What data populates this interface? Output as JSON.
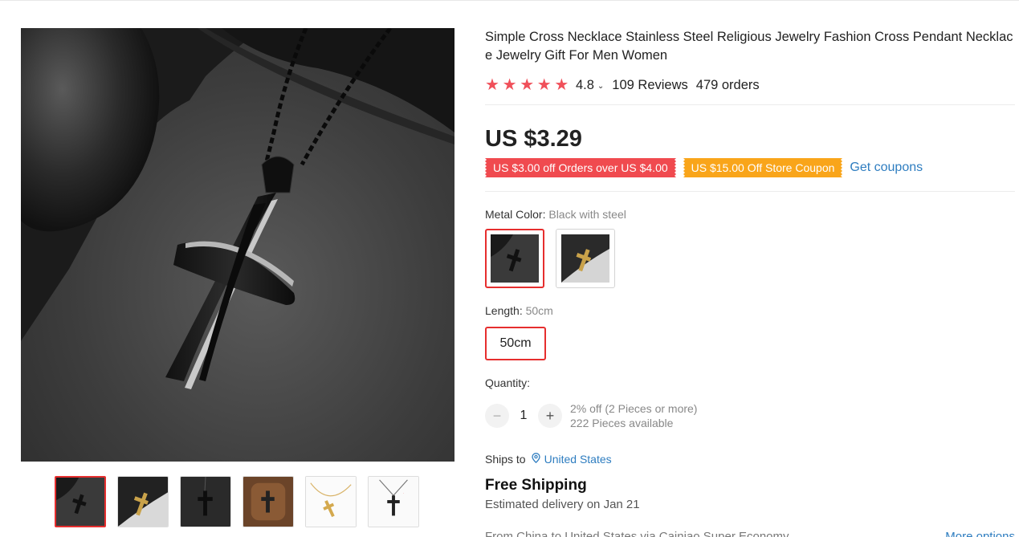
{
  "product": {
    "title": "Simple Cross Necklace Stainless Steel Religious Jewelry Fashion Cross Pendant Necklace Jewelry Gift For Men Women",
    "rating": "4.8",
    "stars": 5,
    "reviews": "109 Reviews",
    "orders": "479 orders",
    "price": "US $3.29"
  },
  "coupons": [
    {
      "text": "US $3.00 off Orders over US $4.00",
      "color": "#f04a4f"
    },
    {
      "text": "US $15.00 Off Store Coupon",
      "color": "#f9a51a"
    }
  ],
  "get_coupons_label": "Get coupons",
  "metal_color": {
    "label": "Metal Color:",
    "value": "Black with steel",
    "options": [
      "Black with steel",
      "Gold with black"
    ]
  },
  "length": {
    "label": "Length:",
    "value": "50cm",
    "options": [
      "50cm"
    ]
  },
  "quantity": {
    "label": "Quantity:",
    "value": "1",
    "minus": "−",
    "plus": "+",
    "discount": "2% off (2 Pieces or more)",
    "available": "222 Pieces available"
  },
  "shipping": {
    "ships_to_label": "Ships to",
    "country": "United States",
    "free_shipping": "Free Shipping",
    "delivery": "Estimated delivery on Jan 21",
    "method_line": "From China to United States via Cainiao Super Economy",
    "more_options": "More options"
  },
  "gallery": {
    "thumbnails": [
      "black-cross",
      "gold-cross-dark",
      "black-cross-dark",
      "cross-on-wood",
      "gold-cross-white",
      "black-cross-white"
    ],
    "active_index": 0
  },
  "colors": {
    "accent": "#e62e2e",
    "link": "#2e7dc0",
    "star": "#f0505a"
  }
}
